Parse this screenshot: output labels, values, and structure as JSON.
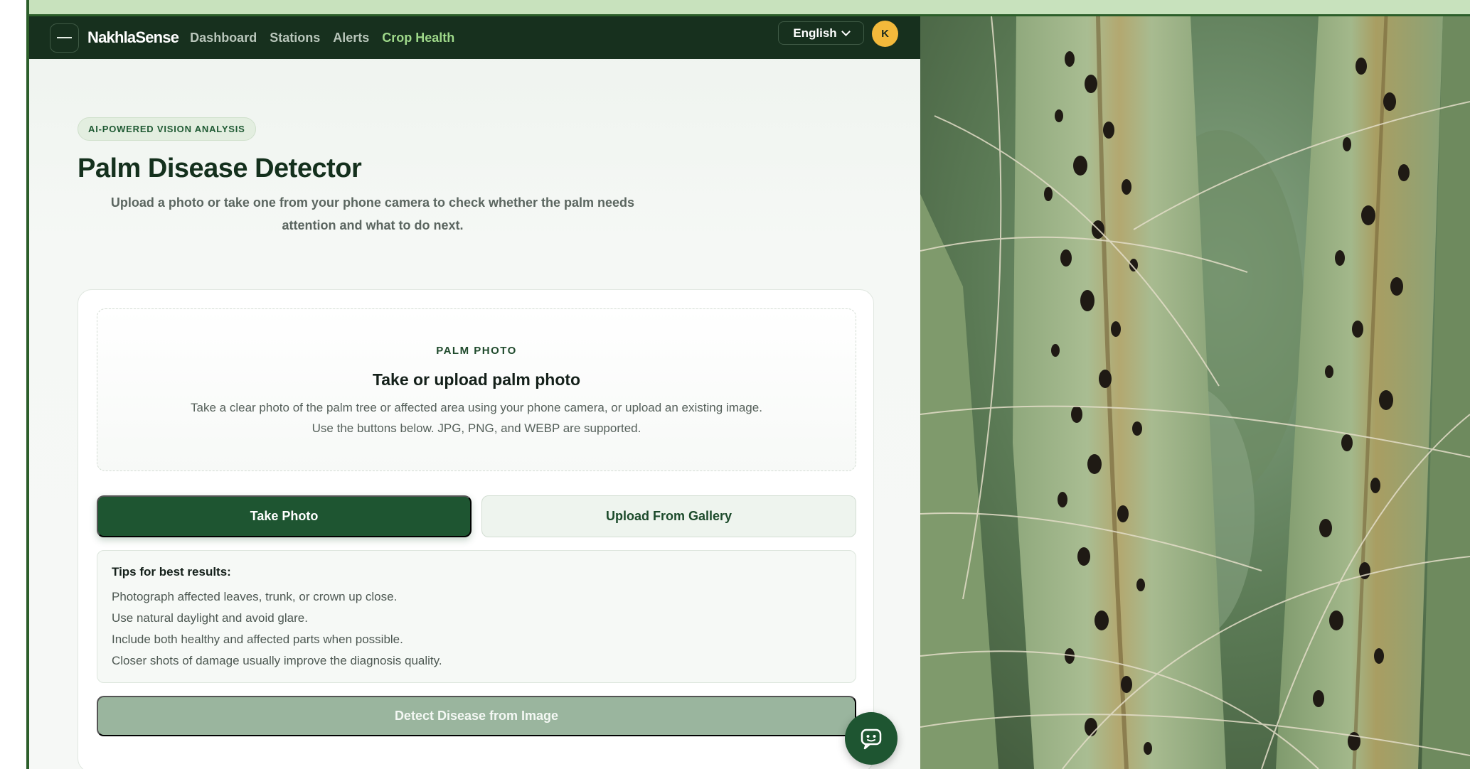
{
  "nav": {
    "brand": "NakhlaSense",
    "links": [
      "Dashboard",
      "Stations",
      "Alerts",
      "Crop Health"
    ],
    "active": "Crop Health",
    "language": "English",
    "avatar_initial": "K"
  },
  "hero": {
    "badge": "AI-POWERED VISION ANALYSIS",
    "title": "Palm Disease Detector",
    "subtitle": "Upload a photo or take one from your phone camera to check whether the palm needs attention and what to do next."
  },
  "upload": {
    "label": "PALM PHOTO",
    "title": "Take or upload palm photo",
    "desc_line1": "Take a clear photo of the palm tree or affected area using your phone camera, or upload an existing image.",
    "desc_line2": "Use the buttons below. JPG, PNG, and WEBP are supported.",
    "take_photo": "Take Photo",
    "upload_gallery": "Upload From Gallery"
  },
  "tips": {
    "title": "Tips for best results:",
    "items": [
      "Photograph affected leaves, trunk, or crown up close.",
      "Use natural daylight and avoid glare.",
      "Include both healthy and affected parts when possible.",
      "Closer shots of damage usually improve the diagnosis quality."
    ]
  },
  "detect_button": "Detect Disease from Image",
  "icons": [
    "menu-icon",
    "chevron-down-icon",
    "chatbot-icon"
  ],
  "colors": {
    "nav_bg": "#17301e",
    "accent_green": "#1e5531",
    "active_link": "#9fd98a",
    "avatar": "#f3b93b",
    "detect_disabled": "#9ab59e"
  }
}
